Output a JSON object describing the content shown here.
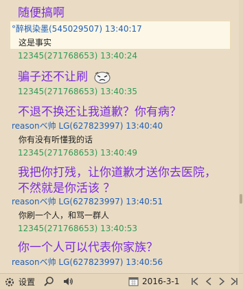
{
  "messages": [
    {
      "type": "big",
      "text": "随便搞啊"
    },
    {
      "type": "header",
      "color": "blue",
      "sender": "°醉枫染墨(545029507) 13:40:17"
    },
    {
      "type": "plain",
      "text": "这是事实"
    },
    {
      "type": "header",
      "color": "green",
      "sender": "12345(271768653) 13:40:24"
    },
    {
      "type": "big",
      "text": "骗子还不让刷"
    },
    {
      "type": "header",
      "color": "green",
      "sender": "12345(271768653) 13:40:35"
    },
    {
      "type": "big",
      "text": "不退不换还让我道歉？你有病？"
    },
    {
      "type": "header",
      "color": "blue",
      "sender": "reasonベ帅 LG(627823997) 13:40:40"
    },
    {
      "type": "plain",
      "text": "你有没有听懂我的话"
    },
    {
      "type": "header",
      "color": "green",
      "sender": "12345(271768653) 13:40:49"
    },
    {
      "type": "big",
      "text": "我把你打残，让你道歉才送你去医院，"
    },
    {
      "type": "big",
      "text": "不然就是你活该 ？"
    },
    {
      "type": "header",
      "color": "blue",
      "sender": "reasonベ帅 LG(627823997) 13:40:51"
    },
    {
      "type": "plain",
      "text": "你刷一个人，和骂一群人"
    },
    {
      "type": "header",
      "color": "green",
      "sender": "12345(271768653) 13:40:53"
    },
    {
      "type": "big",
      "text": "你一个人可以代表你家族？"
    },
    {
      "type": "header",
      "color": "blue",
      "sender": "reasonベ帅 LG(627823997) 13:40:56"
    }
  ],
  "toolbar": {
    "settings_label": "设置",
    "date": "2016-3-1"
  },
  "icons": {
    "settings": "gear-icon",
    "search": "search-icon",
    "voice": "speaker-icon",
    "calendar": "calendar-icon",
    "first": "first-page-icon",
    "prev": "prev-page-icon",
    "next": "next-page-icon",
    "last": "last-page-icon"
  }
}
